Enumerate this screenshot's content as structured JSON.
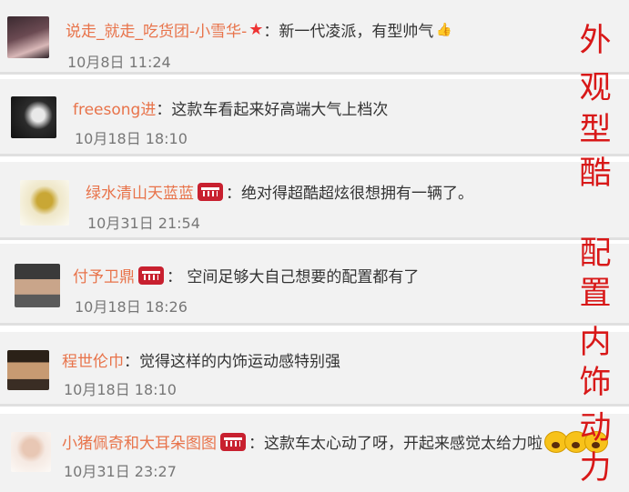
{
  "comments": [
    {
      "username": "说走_就走_吃货团-小雪华-",
      "text": "：新一代凌派，有型帅气",
      "time": "10月8日 11:24",
      "icon": "star-icon+thumbs-up-icon"
    },
    {
      "username": "freesong进",
      "text": "：这款车看起来好高端大气上档次",
      "time": "10月18日 18:10"
    },
    {
      "username": "绿水清山天蓝蓝",
      "text": "：绝对得超酷超炫很想拥有一辆了。",
      "time": "10月31日 21:54",
      "icon": "member-badge-icon"
    },
    {
      "username": "付予卫鼎",
      "text": "：  空间足够大自己想要的配置都有了",
      "time": "10月18日 18:26",
      "icon": "member-badge-icon"
    },
    {
      "username": "程世伦巾",
      "text": "：觉得这样的内饰运动感特别强",
      "time": "10月18日 18:10"
    },
    {
      "username": "小猪佩奇和大耳朵图图",
      "text": "：这款车太心动了呀，开起来感觉太给力啦",
      "time": "10月31日 23:27",
      "icon": "member-badge-icon+emoji-icons"
    }
  ],
  "side_labels": {
    "appearance": [
      "外",
      "观",
      "型",
      "酷"
    ],
    "config": [
      "配",
      "置"
    ],
    "interior": [
      "内",
      "饰"
    ],
    "power": [
      "动",
      "力"
    ]
  },
  "colors": {
    "username": "#e8734a",
    "side_label": "#d81818",
    "card_bg": "#f2f2f2"
  }
}
